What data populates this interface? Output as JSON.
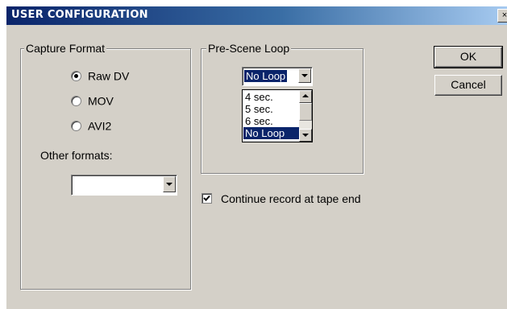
{
  "window": {
    "title": "USER CONFIGURATION",
    "close_glyph": "×"
  },
  "capture_format": {
    "legend": "Capture Format",
    "options": [
      "Raw DV",
      "MOV",
      "AVI2"
    ],
    "selected": "Raw DV",
    "other_formats_label": "Other formats:",
    "other_formats_value": ""
  },
  "pre_scene_loop": {
    "legend": "Pre-Scene Loop",
    "selected_value": "No Loop",
    "list_options": [
      "4 sec.",
      "5 sec.",
      "6 sec.",
      "No Loop"
    ],
    "highlighted_option": "No Loop"
  },
  "continue_record": {
    "label": "Continue record at tape end",
    "checked": true
  },
  "buttons": {
    "ok": "OK",
    "cancel": "Cancel"
  },
  "colors": {
    "dialog_bg": "#d4d0c8",
    "selection": "#0a246a",
    "title_start": "#0a246a",
    "title_end": "#a6caf0"
  }
}
